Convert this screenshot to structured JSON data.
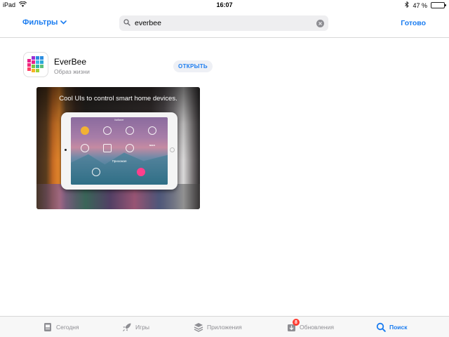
{
  "status_bar": {
    "device": "iPad",
    "time": "16:07",
    "battery": "47 %",
    "battery_level": 0.47
  },
  "nav": {
    "filter_label": "Фильтры",
    "search_value": "everbee",
    "done_label": "Готово"
  },
  "result": {
    "app_name": "EverBee",
    "category": "Образ жизни",
    "open_label": "ОТКРЫТЬ",
    "screenshot": {
      "caption": "Cool UIs to control smart home devices.",
      "screen_title": "Кабинет",
      "room_label": "Прихожая",
      "brand": "NEEO"
    }
  },
  "tabs": [
    {
      "label": "Сегодня",
      "icon": "today-icon"
    },
    {
      "label": "Игры",
      "icon": "games-rocket-icon"
    },
    {
      "label": "Приложения",
      "icon": "apps-stack-icon"
    },
    {
      "label": "Обновления",
      "icon": "updates-icon",
      "badge": "8"
    },
    {
      "label": "Поиск",
      "icon": "search-icon",
      "active": true
    }
  ],
  "colors": {
    "accent": "#1a7cf0",
    "badge": "#ff3b30",
    "tab_inactive": "#8e8e93"
  }
}
